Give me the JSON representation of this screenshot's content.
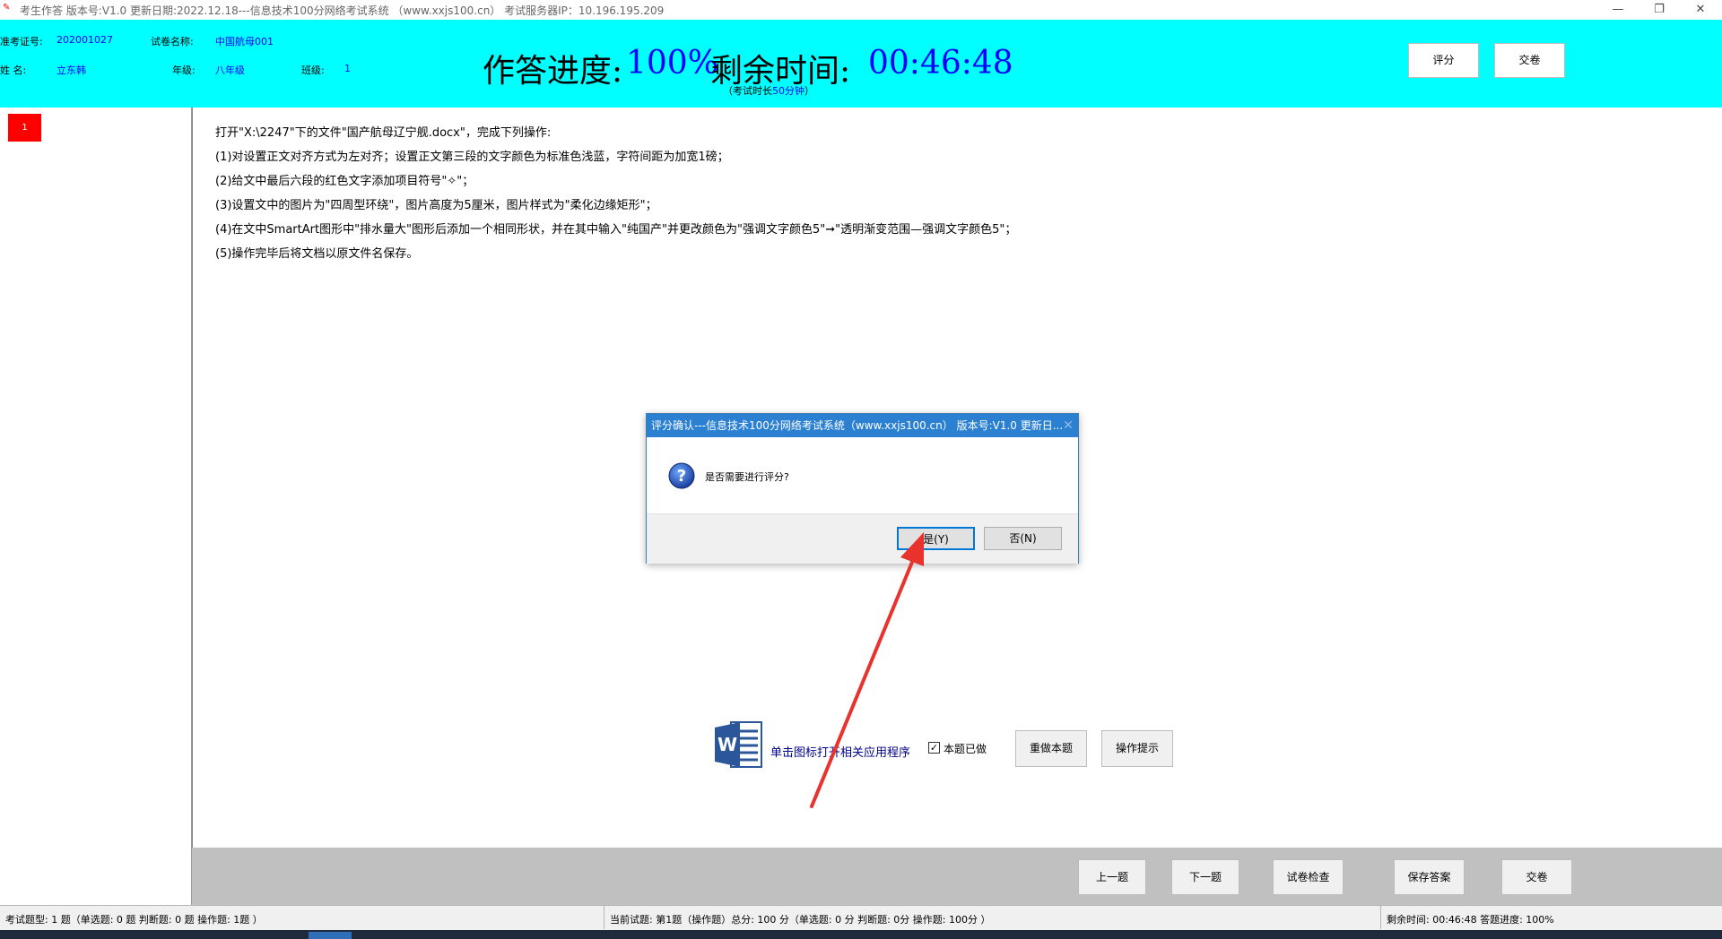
{
  "window": {
    "title": "考生作答 版本号:V1.0 更新日期:2022.12.18---信息技术100分网络考试系统 （www.xxjs100.cn）   考试服务器IP：10.196.195.209",
    "icon_name": "exam-app-icon",
    "controls": [
      "—",
      "❐",
      "✕"
    ]
  },
  "header": {
    "exam_id_label": "准考证号:",
    "exam_id": "202001027",
    "paper_label": "试卷名称:",
    "paper_name": "中国航母001",
    "name_label": "姓    名:",
    "name": "立东韩",
    "grade_label": "年级:",
    "grade": "八年级",
    "class_label": "班级:",
    "class": "1",
    "progress_label": "作答进度:",
    "progress_value": "100%",
    "remaining_label": "剩余时间:",
    "remaining_value": "00:46:48",
    "duration_note_prefix": "（考试时长",
    "duration_value": "50分钟",
    "duration_note_suffix": "）",
    "score_button": "评分",
    "submit_button": "交卷"
  },
  "sidebar": {
    "questions": [
      {
        "label": "1",
        "color": "#ff0000"
      }
    ]
  },
  "question": {
    "lines": [
      "打开\"X:\\2247\"下的文件\"国产航母辽宁舰.docx\"，完成下列操作:",
      "(1)对设置正文对齐方式为左对齐；设置正文第三段的文字颜色为标准色浅蓝，字符间距为加宽1磅；",
      "(2)给文中最后六段的红色文字添加项目符号\"✧\"；",
      "(3)设置文中的图片为\"四周型环绕\"，图片高度为5厘米，图片样式为\"柔化边缘矩形\"；",
      "(4)在文中SmartArt图形中\"排水量大\"图形后添加一个相同形状，并在其中输入\"纯国产\"并更改颜色为\"强调文字颜色5\"➞\"透明渐变范围—强调文字颜色5\"；",
      "(5)操作完毕后将文档以原文件名保存。"
    ]
  },
  "actions": {
    "open_app_hint": "单击图标打开相关应用程序",
    "done_checkbox_label": "本题已做",
    "done_checked": true,
    "redo_button": "重做本题",
    "tips_button": "操作提示"
  },
  "nav": {
    "prev": "上一题",
    "next": "下一题",
    "check": "试卷检查",
    "save": "保存答案",
    "submit": "交卷"
  },
  "dialog": {
    "title": "评分确认---信息技术100分网络考试系统（www.xxjs100.cn） 版本号:V1.0 更新日...",
    "message": "是否需要进行评分?",
    "yes": "是(Y)",
    "no": "否(N)"
  },
  "status": {
    "types": "考试题型: 1 题（单选题: 0 题 判断题: 0 题 操作题: 1题 ）",
    "current": "当前试题: 第1题（操作题）总分: 100 分（单选题: 0 分 判断题: 0分 操作题: 100分 ）",
    "remaining": "剩余时间: 00:46:48 答题进度: 100%"
  },
  "colors": {
    "header_bg": "#00ffff",
    "accent_blue": "#0000ff",
    "dialog_title_bg": "#2b80d1",
    "arrow_red": "#e8322e"
  }
}
